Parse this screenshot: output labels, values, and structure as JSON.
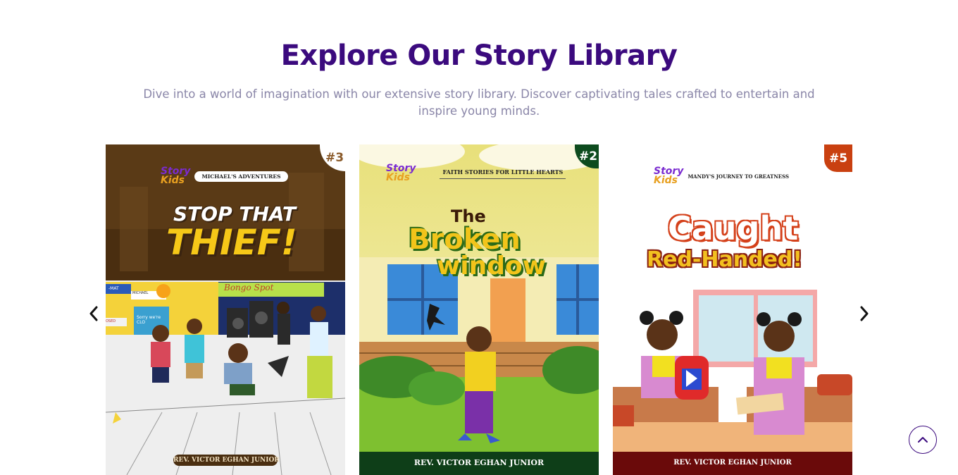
{
  "section": {
    "title": "Explore Our Story Library",
    "subtitle": "Dive into a world of imagination with our extensive story library. Discover captivating tales crafted to entertain and inspire young minds."
  },
  "carousel": {
    "prev_icon": "chevron-left-icon",
    "next_icon": "chevron-right-icon",
    "books": [
      {
        "rank": "#3",
        "logo_top": "Story",
        "logo_bottom": "Kids",
        "series": "MICHAEL'S ADVENTURES",
        "title_line1": "STOP THAT",
        "title_line2": "THIEF!",
        "author": "REV. VICTOR EGHAN JUNIOR",
        "shop_sign": "Bongo Spot",
        "store_sign": "MICHAEL",
        "store_left": "-MAT",
        "door_sign": "Sorry we're CLO",
        "door_sign2": "OSED"
      },
      {
        "rank": "#2",
        "logo_top": "Story",
        "logo_bottom": "Kids",
        "series": "FAITH STORIES FOR LITTLE HEARTS",
        "title_line1": "The",
        "title_line2": "Broken",
        "title_line3": "window",
        "author": "REV. VICTOR EGHAN JUNIOR"
      },
      {
        "rank": "#5",
        "logo_top": "Story",
        "logo_bottom": "Kids",
        "series": "MANDY'S JOURNEY TO GREATNESS",
        "title_line1": "Caught",
        "title_line2": "Red-Handed!",
        "author": "REV. VICTOR EGHAN JUNIOR"
      }
    ]
  },
  "scroll_top_icon": "chevron-up-icon",
  "colors": {
    "heading": "#3b0a7e",
    "subtitle": "#8a86a8"
  }
}
